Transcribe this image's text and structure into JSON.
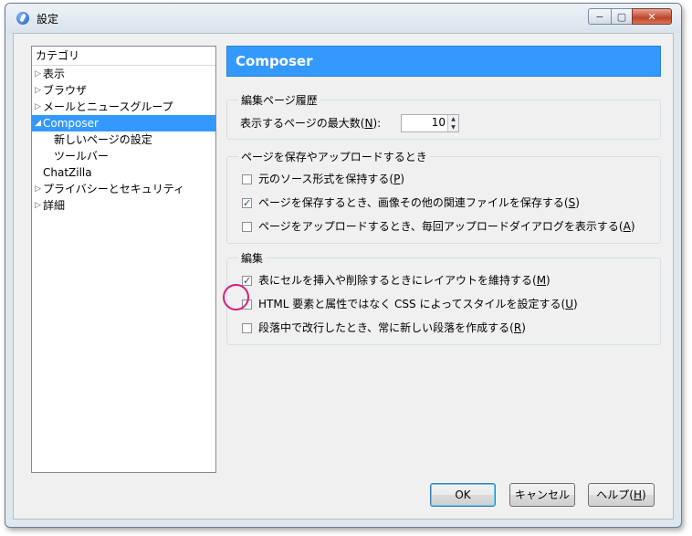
{
  "window": {
    "title": "設定",
    "close_symbol": "✕",
    "minimize_symbol": "−",
    "maximize_symbol": "▢"
  },
  "category": {
    "header": "カテゴリ",
    "items": [
      {
        "label": "表示",
        "indent": 0,
        "twisty": "▷",
        "selected": false
      },
      {
        "label": "ブラウザ",
        "indent": 0,
        "twisty": "▷",
        "selected": false
      },
      {
        "label": "メールとニュースグループ",
        "indent": 0,
        "twisty": "▷",
        "selected": false
      },
      {
        "label": "Composer",
        "indent": 0,
        "twisty": "◢",
        "selected": true
      },
      {
        "label": "新しいページの設定",
        "indent": 2,
        "twisty": "",
        "selected": false
      },
      {
        "label": "ツールバー",
        "indent": 2,
        "twisty": "",
        "selected": false
      },
      {
        "label": "ChatZilla",
        "indent": 1,
        "twisty": "",
        "selected": false
      },
      {
        "label": "プライバシーとセキュリティ",
        "indent": 0,
        "twisty": "▷",
        "selected": false
      },
      {
        "label": "詳細",
        "indent": 0,
        "twisty": "▷",
        "selected": false
      }
    ]
  },
  "panel": {
    "title": "Composer",
    "history": {
      "legend": "編集ページ履歴",
      "max_pages_label": "表示するページの最大数(",
      "max_pages_key": "N",
      "max_pages_suffix": "):",
      "max_pages_value": "10"
    },
    "save_upload": {
      "legend": "ページを保存やアップロードするとき",
      "options": [
        {
          "label": "元のソース形式を保持する(",
          "key": "P",
          "suffix": ")",
          "checked": false
        },
        {
          "label": "ページを保存するとき、画像その他の関連ファイルを保存する(",
          "key": "S",
          "suffix": ")",
          "checked": true
        },
        {
          "label": "ページをアップロードするとき、毎回アップロードダイアログを表示する(",
          "key": "A",
          "suffix": ")",
          "checked": false
        }
      ]
    },
    "editing": {
      "legend": "編集",
      "options": [
        {
          "label": "表にセルを挿入や削除するときにレイアウトを維持する(",
          "key": "M",
          "suffix": ")",
          "checked": true
        },
        {
          "label": "HTML 要素と属性ではなく CSS によってスタイルを設定する(",
          "key": "U",
          "suffix": ")",
          "checked": false
        },
        {
          "label": "段落中で改行したとき、常に新しい段落を作成する(",
          "key": "R",
          "suffix": ")",
          "checked": false
        }
      ]
    }
  },
  "buttons": {
    "ok": "OK",
    "cancel": "キャンセル",
    "help_label": "ヘルプ(",
    "help_key": "H",
    "help_suffix": ")"
  },
  "colors": {
    "selection": "#3399ff",
    "highlight_ring": "#d61f7d"
  }
}
